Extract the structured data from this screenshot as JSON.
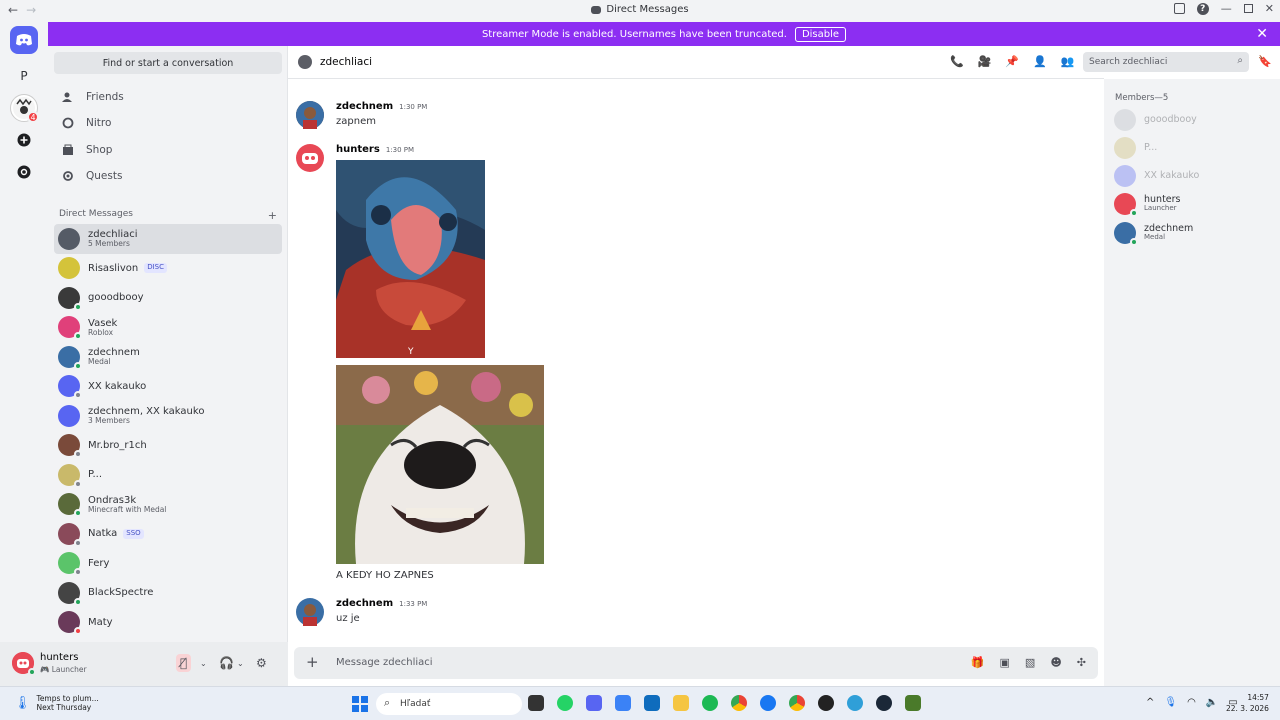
{
  "window": {
    "title": "Direct Messages"
  },
  "banner": {
    "text": "Streamer Mode is enabled. Usernames have been truncated.",
    "button": "Disable",
    "color": "#8c2ef2"
  },
  "rail": {
    "letter": "P",
    "badge": "4"
  },
  "sidebar": {
    "search_placeholder": "Find or start a conversation",
    "nav": [
      {
        "label": "Friends",
        "icon": "friends-icon"
      },
      {
        "label": "Nitro",
        "icon": "nitro-icon"
      },
      {
        "label": "Shop",
        "icon": "shop-icon"
      },
      {
        "label": "Quests",
        "icon": "quests-icon"
      }
    ],
    "dm_header": "Direct Messages",
    "dms": [
      {
        "name": "zdechliaci",
        "sub": "5 Members",
        "status": "group",
        "active": true
      },
      {
        "name": "Risaslivon",
        "sub": "",
        "tag": "DISC",
        "status": "none"
      },
      {
        "name": "gooodbooy",
        "sub": "",
        "status": "on"
      },
      {
        "name": "Vasek",
        "sub": "Roblox",
        "status": "on"
      },
      {
        "name": "zdechnem",
        "sub": "Medal",
        "status": "on"
      },
      {
        "name": "XX kakauko",
        "sub": "",
        "status": "off"
      },
      {
        "name": "zdechnem, XX kakauko",
        "sub": "3 Members",
        "status": "group"
      },
      {
        "name": "Mr.bro_r1ch",
        "sub": "",
        "status": "off"
      },
      {
        "name": "P...",
        "sub": "",
        "status": "off"
      },
      {
        "name": "Ondras3k",
        "sub": "Minecraft with Medal",
        "status": "on"
      },
      {
        "name": "Natka",
        "sub": "",
        "tag": "SSO",
        "status": "off"
      },
      {
        "name": "Fery",
        "sub": "",
        "status": "off"
      },
      {
        "name": "BlackSpectre",
        "sub": "",
        "status": "on"
      },
      {
        "name": "Maty",
        "sub": "",
        "status": "dnd"
      }
    ]
  },
  "user": {
    "name": "hunters",
    "status": "Launcher"
  },
  "chat": {
    "channel": "zdechliaci",
    "search_placeholder": "Search zdechliaci",
    "composer_placeholder": "Message zdechliaci",
    "messages": [
      {
        "author": "zdechnem",
        "time": "1:30 PM",
        "text": "zapnem"
      },
      {
        "author": "hunters",
        "time": "1:30 PM",
        "text": ""
      },
      {
        "author": "zdechnem",
        "time": "1:33 PM",
        "text": "uz je"
      }
    ],
    "image_letter": "Y",
    "caption": "A KEDY HO ZAPNES"
  },
  "members": {
    "header": "Members—5",
    "list": [
      {
        "name": "gooodbooy",
        "sub": "",
        "faded": true
      },
      {
        "name": "P...",
        "sub": "",
        "faded": true
      },
      {
        "name": "XX kakauko",
        "sub": "",
        "faded": true
      },
      {
        "name": "hunters",
        "sub": "Launcher",
        "faded": false
      },
      {
        "name": "zdechnem",
        "sub": "Medal",
        "faded": false
      }
    ]
  },
  "taskbar": {
    "weather_line1": "Temps to plum...",
    "weather_line2": "Next Thursday",
    "search_placeholder": "Hľadať",
    "time": "14:57",
    "date": "22. 3. 2026"
  }
}
